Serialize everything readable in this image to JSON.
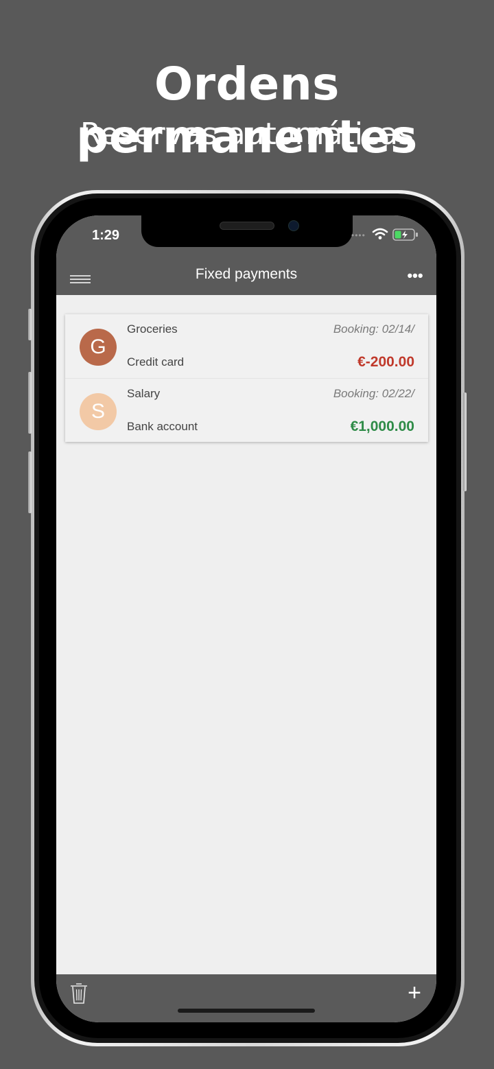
{
  "promo": {
    "title": "Ordens permanentes",
    "subtitle": "Reservas automáticas"
  },
  "statusbar": {
    "time": "1:29",
    "signal_icon": "signal-dots-icon",
    "wifi_icon": "wifi-icon",
    "battery_icon": "battery-charging-icon"
  },
  "navbar": {
    "title": "Fixed payments",
    "menu_icon": "hamburger-menu-icon",
    "more_icon": "more-options-icon",
    "more_label": "•••"
  },
  "payments": [
    {
      "avatar_letter": "G",
      "avatar_color": "#b9694a",
      "name": "Groceries",
      "booking": "Booking: 02/14/",
      "account": "Credit card",
      "amount": "€-200.00",
      "amount_color": "#c0392b"
    },
    {
      "avatar_letter": "S",
      "avatar_color": "#f2c9a6",
      "name": "Salary",
      "booking": "Booking: 02/22/",
      "account": "Bank account",
      "amount": "€1,000.00",
      "amount_color": "#2e8b47"
    }
  ],
  "toolbar": {
    "delete_icon": "trash-icon",
    "add_icon": "plus-icon",
    "add_label": "+"
  },
  "colors": {
    "background": "#595959",
    "bar": "#5a5a5a",
    "screen_bg": "#efefef",
    "negative": "#c0392b",
    "positive": "#2e8b47"
  }
}
